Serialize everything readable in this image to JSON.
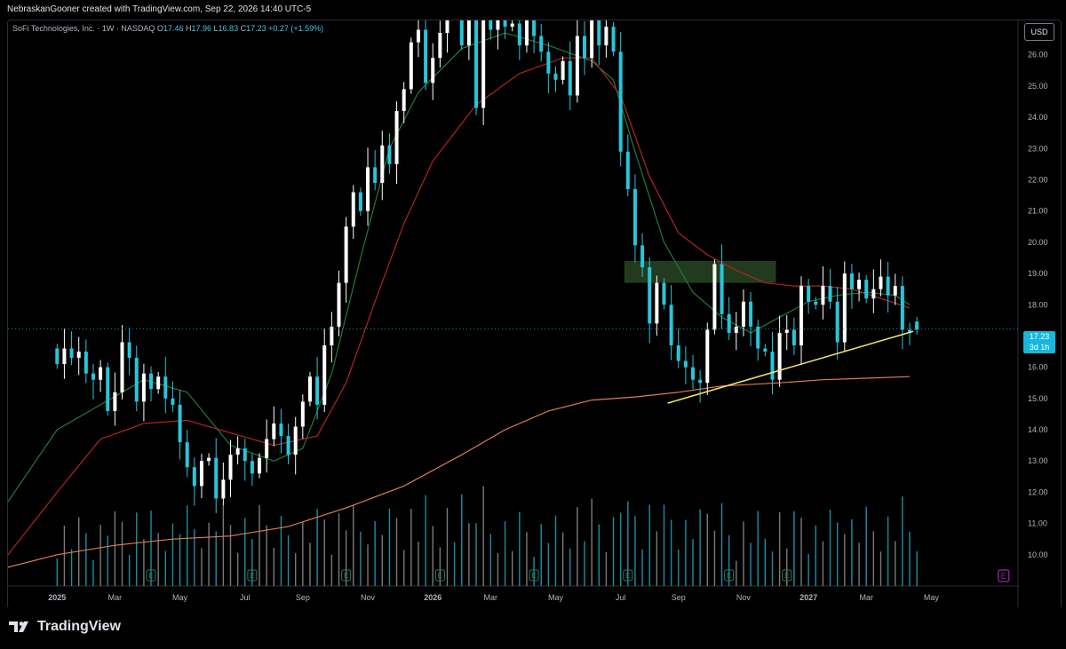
{
  "header": {
    "text": "NebraskanGooner created with TradingView.com, Sep 22, 2026 14:40 UTC-5"
  },
  "legend": {
    "symbol": "SoFi Technologies, Inc. · 1W · NASDAQ",
    "o_label": "O",
    "o": "17.46",
    "h_label": "H",
    "h": "17.96",
    "l_label": "L",
    "l": "16.83",
    "c_label": "C",
    "c": "17.23",
    "change": "+0.27 (+1.59%)"
  },
  "currency_button": "USD",
  "price_tag": {
    "price": "17.23",
    "countdown": "3d 1h"
  },
  "brand": "TradingView",
  "colors": {
    "bull": "#ffffff",
    "bear": "#26c6da",
    "ma_fast": "#1f7a3a",
    "ma_mid": "#b3261e",
    "ma_slow": "#e07b53",
    "trendline": "#f5e76a",
    "zone": "#2e4f2a",
    "earnings": "#2e7d5b",
    "earnings_upcoming": "#9c27b0",
    "price_tag": "#16b7de"
  },
  "icons": {
    "logo": "tradingview-logo-icon",
    "earnings": "earnings-e-icon"
  },
  "chart_data": {
    "type": "candlestick",
    "timeframe": "1W",
    "x_tick_labels": [
      "2025",
      "Mar",
      "May",
      "Jul",
      "Sep",
      "Nov",
      "2026",
      "Mar",
      "May",
      "Jul",
      "Sep",
      "Nov",
      "2027",
      "Mar",
      "May"
    ],
    "x_tick_weeks": [
      0,
      8,
      17,
      26,
      34,
      43,
      52,
      60,
      69,
      78,
      86,
      95,
      104,
      112,
      121
    ],
    "y_tick_labels": [
      "10.00",
      "11.00",
      "12.00",
      "13.00",
      "14.00",
      "15.00",
      "16.00",
      "17.00",
      "18.00",
      "19.00",
      "20.00",
      "21.00",
      "22.00",
      "23.00",
      "24.00",
      "25.00",
      "26.00"
    ],
    "y_tick_values": [
      10,
      11,
      12,
      13,
      14,
      15,
      16,
      17,
      18,
      19,
      20,
      21,
      22,
      23,
      24,
      25,
      26
    ],
    "ylim": [
      9.0,
      27.1
    ],
    "x_range_weeks": [
      -6.8,
      133
    ],
    "last_price": 17.23,
    "candles_close": [
      16.1,
      16.6,
      16.3,
      16.5,
      15.8,
      15.6,
      16.0,
      14.6,
      15.2,
      16.8,
      16.3,
      14.9,
      15.8,
      15.3,
      15.7,
      15.0,
      14.8,
      13.6,
      12.8,
      12.2,
      13.0,
      13.1,
      11.8,
      12.4,
      13.2,
      13.4,
      13.0,
      12.6,
      13.1,
      13.7,
      14.2,
      13.8,
      13.2,
      14.1,
      14.9,
      15.7,
      14.8,
      16.7,
      17.3,
      18.7,
      20.5,
      21.6,
      21.0,
      22.4,
      21.9,
      23.1,
      22.5,
      24.2,
      24.9,
      26.4,
      26.8,
      25.1,
      25.9,
      26.7,
      28.1,
      27.9,
      26.3,
      27.2,
      24.3,
      27.6,
      26.8,
      27.8,
      26.9,
      27.0,
      26.3,
      27.1,
      26.6,
      26.1,
      25.4,
      25.2,
      25.8,
      24.7,
      26.6,
      25.9,
      27.5,
      26.3,
      26.9,
      26.1,
      22.9,
      21.7,
      19.9,
      19.2,
      17.4,
      18.7,
      18.0,
      16.7,
      16.2,
      16.0,
      15.6,
      15.5,
      17.2,
      19.3,
      17.7,
      17.1,
      17.3,
      18.1,
      17.3,
      16.6,
      16.5,
      15.6,
      17.1,
      17.2,
      16.7,
      18.6,
      18.1,
      18.0,
      18.6,
      18.1,
      16.8,
      19.0,
      18.5,
      18.8,
      18.2,
      18.5,
      18.9,
      18.3,
      18.6,
      17.2,
      17.1,
      17.2
    ],
    "candles_open": [
      16.6,
      16.1,
      16.6,
      16.3,
      16.5,
      15.8,
      15.6,
      16.0,
      14.6,
      15.2,
      16.8,
      16.3,
      14.9,
      15.8,
      15.3,
      15.7,
      15.0,
      14.8,
      13.6,
      12.8,
      12.2,
      13.0,
      13.1,
      11.8,
      12.4,
      13.2,
      13.4,
      13.0,
      12.6,
      13.1,
      13.7,
      14.2,
      13.8,
      13.2,
      14.1,
      14.9,
      15.7,
      14.8,
      16.7,
      17.3,
      18.7,
      20.5,
      21.6,
      21.0,
      22.4,
      21.9,
      23.1,
      22.5,
      24.2,
      24.9,
      26.4,
      26.8,
      25.1,
      25.9,
      26.7,
      28.1,
      27.9,
      26.3,
      27.2,
      24.3,
      27.6,
      26.8,
      27.8,
      26.9,
      27.0,
      26.3,
      27.1,
      26.6,
      26.1,
      25.4,
      25.2,
      25.8,
      24.7,
      26.6,
      25.9,
      27.5,
      26.3,
      26.9,
      26.1,
      22.9,
      21.7,
      19.9,
      19.2,
      17.4,
      18.7,
      18.0,
      16.7,
      16.2,
      16.0,
      15.6,
      15.5,
      17.2,
      19.3,
      17.7,
      17.1,
      17.3,
      18.1,
      17.3,
      16.6,
      16.5,
      15.6,
      17.1,
      17.2,
      16.7,
      18.6,
      18.1,
      18.0,
      18.6,
      18.1,
      16.8,
      19.0,
      18.5,
      18.8,
      18.2,
      18.5,
      18.9,
      18.3,
      18.6,
      17.2,
      17.46
    ],
    "support_zone": {
      "from": 18.7,
      "to": 19.4,
      "week_start": 78.5,
      "week_end": 99.5
    },
    "trendline": [
      {
        "week": 84.5,
        "price": 14.85
      },
      {
        "week": 118.5,
        "price": 17.15
      }
    ],
    "moving_averages": [
      {
        "id": "fast",
        "points": [
          [
            -6.8,
            11.7
          ],
          [
            0,
            14.0
          ],
          [
            6,
            14.8
          ],
          [
            12,
            15.6
          ],
          [
            18,
            15.2
          ],
          [
            24,
            13.5
          ],
          [
            30,
            13.0
          ],
          [
            34,
            13.4
          ],
          [
            38,
            15.8
          ],
          [
            42,
            19.5
          ],
          [
            46,
            23.0
          ],
          [
            50,
            24.8
          ],
          [
            56,
            26.2
          ],
          [
            62,
            26.7
          ],
          [
            68,
            26.3
          ],
          [
            74,
            25.8
          ],
          [
            77,
            25.2
          ],
          [
            80,
            22.9
          ],
          [
            84,
            20.0
          ],
          [
            88,
            18.4
          ],
          [
            92,
            17.6
          ],
          [
            96,
            17.1
          ],
          [
            100,
            17.6
          ],
          [
            104,
            18.1
          ],
          [
            108,
            18.3
          ],
          [
            112,
            18.4
          ],
          [
            116,
            18.3
          ],
          [
            118,
            18.0
          ]
        ]
      },
      {
        "id": "mid",
        "points": [
          [
            -6.8,
            10.0
          ],
          [
            0,
            12.0
          ],
          [
            6,
            13.7
          ],
          [
            12,
            14.2
          ],
          [
            18,
            14.3
          ],
          [
            24,
            13.9
          ],
          [
            30,
            13.5
          ],
          [
            36,
            13.8
          ],
          [
            40,
            15.5
          ],
          [
            44,
            18.1
          ],
          [
            48,
            20.6
          ],
          [
            52,
            22.6
          ],
          [
            58,
            24.4
          ],
          [
            64,
            25.4
          ],
          [
            70,
            25.9
          ],
          [
            74,
            25.9
          ],
          [
            78,
            24.7
          ],
          [
            82,
            22.1
          ],
          [
            86,
            20.3
          ],
          [
            90,
            19.6
          ],
          [
            94,
            19.1
          ],
          [
            98,
            18.7
          ],
          [
            102,
            18.6
          ],
          [
            106,
            18.6
          ],
          [
            110,
            18.5
          ],
          [
            114,
            18.2
          ],
          [
            118,
            17.9
          ]
        ]
      },
      {
        "id": "slow",
        "points": [
          [
            -6.8,
            9.6
          ],
          [
            0,
            10.0
          ],
          [
            8,
            10.3
          ],
          [
            16,
            10.5
          ],
          [
            24,
            10.6
          ],
          [
            32,
            10.9
          ],
          [
            40,
            11.5
          ],
          [
            48,
            12.2
          ],
          [
            56,
            13.2
          ],
          [
            62,
            14.0
          ],
          [
            68,
            14.6
          ],
          [
            74,
            14.95
          ],
          [
            80,
            15.05
          ],
          [
            86,
            15.2
          ],
          [
            92,
            15.4
          ],
          [
            100,
            15.5
          ],
          [
            106,
            15.6
          ],
          [
            112,
            15.65
          ],
          [
            118,
            15.7
          ]
        ]
      }
    ],
    "earnings_weeks": [
      13,
      27,
      40,
      53,
      66,
      79,
      93,
      101
    ],
    "upcoming_earnings_week": 131
  }
}
